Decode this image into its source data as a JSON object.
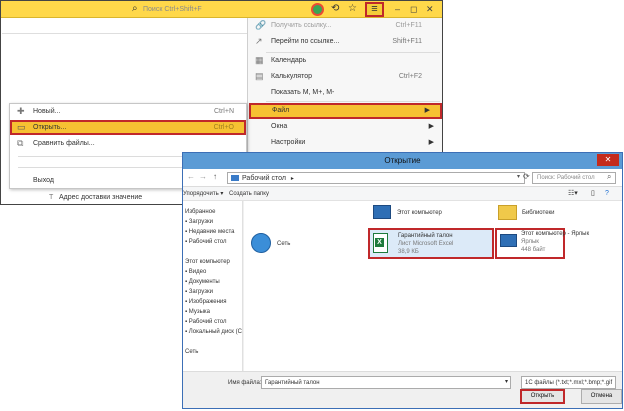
{
  "app": {
    "search_placeholder": "Поиск Ctrl+Shift+F",
    "win_min": "–",
    "win_restore": "◻",
    "win_close": "✕"
  },
  "main_menu": {
    "items": [
      {
        "label": "Получить ссылку...",
        "shortcut": "Ctrl+F11",
        "disabled": true
      },
      {
        "label": "Перейти по ссылке...",
        "shortcut": "Shift+F11"
      },
      {
        "label": "Календарь",
        "shortcut": ""
      },
      {
        "label": "Калькулятор",
        "shortcut": "Ctrl+F2"
      },
      {
        "label": "Показать M, M+, M-",
        "shortcut": ""
      },
      {
        "label": "Файл",
        "shortcut": ""
      },
      {
        "label": "Окна",
        "shortcut": ""
      },
      {
        "label": "Настройки",
        "shortcut": ""
      }
    ]
  },
  "file_menu": {
    "items": [
      {
        "label": "Новый...",
        "shortcut": "Ctrl+N"
      },
      {
        "label": "Открыть...",
        "shortcut": "Ctrl+O"
      },
      {
        "label": "Сравнить файлы...",
        "shortcut": ""
      },
      {
        "label": "Выход",
        "shortcut": ""
      }
    ]
  },
  "background": {
    "address_row": "Адрес доставки значение"
  },
  "dialog": {
    "title": "Открытие",
    "path": "Рабочий стол",
    "search_placeholder": "Поиск: Рабочий стол",
    "toolbar": {
      "organize": "Упорядочить",
      "new_folder": "Создать папку"
    },
    "nav": {
      "favorites": "Избранное",
      "downloads": "Загрузки",
      "recent": "Недавние места",
      "desktop": "Рабочий стол",
      "computer": "Этот компьютер",
      "video": "Видео",
      "documents": "Документы",
      "downloads2": "Загрузки",
      "images": "Изображения",
      "music": "Музыка",
      "desktop2": "Рабочий стол",
      "local_disk": "Локальный диск (C",
      "network": "Сеть"
    },
    "items": {
      "computer": "Этот компьютер",
      "libraries": "Библиотеки",
      "network": "Сеть",
      "file_name": "Гарантийный талон",
      "file_type": "Лист Microsoft Excel",
      "file_size": "38,9 КБ",
      "shortcut_name": "Этот компьютер - Ярлык",
      "shortcut_type": "Ярлык",
      "shortcut_size": "448 байт"
    },
    "filename_label": "Имя файла:",
    "filename_value": "Гарантийный талон",
    "filetype_value": "1С файлы (*.txt;*.mxl;*.bmp;*.gif",
    "open_button": "Открыть",
    "cancel_button": "Отмена"
  }
}
